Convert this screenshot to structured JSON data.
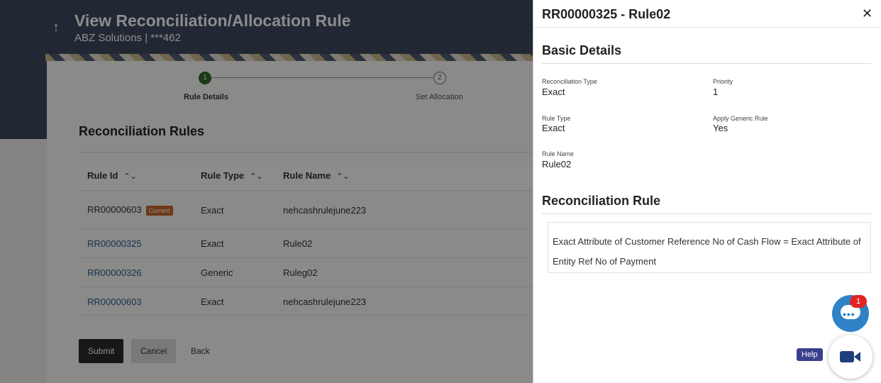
{
  "header": {
    "title": "View Reconciliation/Allocation Rule",
    "subtitle": "ABZ Solutions | ***462"
  },
  "stepper": {
    "steps": [
      {
        "num": "1",
        "label": "Rule Details"
      },
      {
        "num": "2",
        "label": "Set Allocation"
      }
    ]
  },
  "section": {
    "title": "Reconciliation Rules"
  },
  "table": {
    "columns": [
      "Rule Id",
      "Rule Type",
      "Rule Name"
    ],
    "rows": [
      {
        "id": "RR00000603",
        "badge": "Current",
        "type": "Exact",
        "name": "nehcashrulejune223"
      },
      {
        "id": "RR00000325",
        "type": "Exact",
        "name": "Rule02"
      },
      {
        "id": "RR00000326",
        "type": "Generic",
        "name": "Ruleg02"
      },
      {
        "id": "RR00000603",
        "type": "Exact",
        "name": "nehcashrulejune223"
      }
    ]
  },
  "buttons": {
    "submit": "Submit",
    "cancel": "Cancel",
    "back": "Back"
  },
  "panel": {
    "title": "RR00000325 - Rule02",
    "basic_title": "Basic Details",
    "fields": {
      "recon_type_label": "Reconciliation Type",
      "recon_type": "Exact",
      "priority_label": "Priority",
      "priority": "1",
      "rule_type_label": "Rule Type",
      "rule_type": "Exact",
      "apply_generic_label": "Apply Generic Rule",
      "apply_generic": "Yes",
      "rule_name_label": "Rule Name",
      "rule_name": "Rule02"
    },
    "rule_title": "Reconciliation Rule",
    "rule_text": "Exact Attribute of Customer Reference No of Cash Flow = Exact Attribute of Entity Ref No of Payment"
  },
  "widgets": {
    "notification_count": "1",
    "help_label": "Help"
  },
  "icons": {
    "back": "arrow-up-icon",
    "close": "close-icon",
    "sort": "sort-icon",
    "chat": "chat-icon",
    "video": "video-camera-icon"
  }
}
